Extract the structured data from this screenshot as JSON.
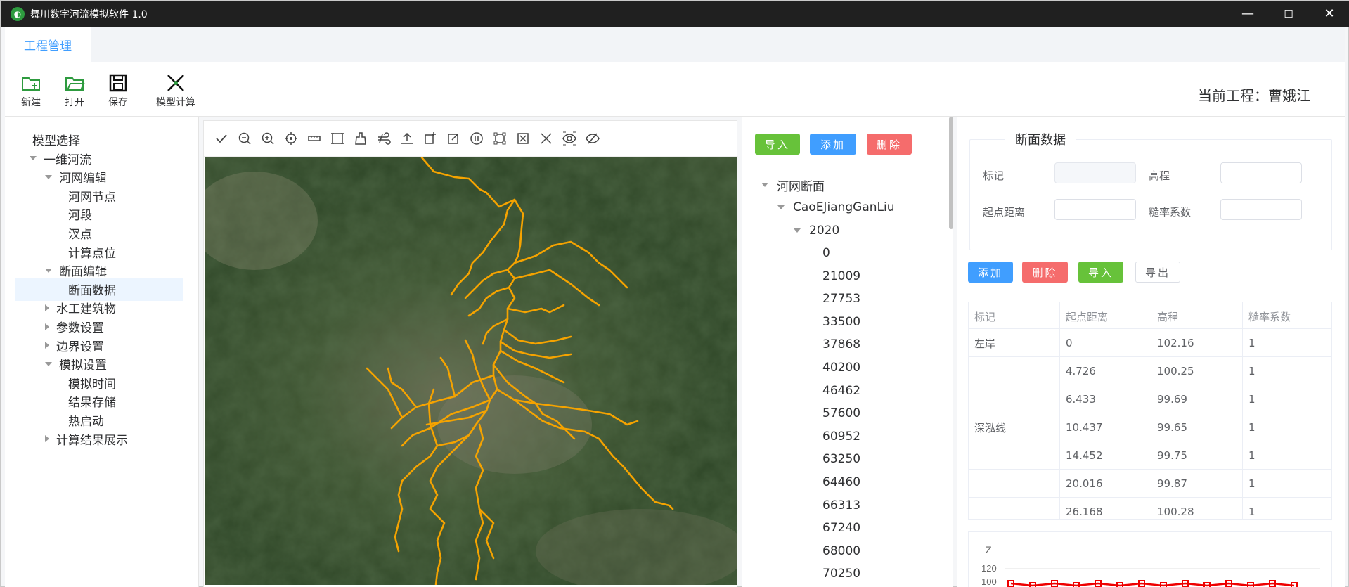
{
  "window": {
    "title": "舞川数字河流模拟软件 1.0",
    "logo_icon": "river-logo-icon",
    "controls": {
      "minimize": "—",
      "maximize": "☐",
      "close": "✕"
    }
  },
  "tabs": [
    {
      "label": "工程管理",
      "active": true
    }
  ],
  "ribbon": {
    "new_label": "新建",
    "open_label": "打开",
    "save_label": "保存",
    "compute_label": "模型计算",
    "current_project": "当前工程：曹娥江"
  },
  "sidebar": {
    "items": [
      {
        "label": "模型选择",
        "level": 0,
        "arrow": "none"
      },
      {
        "label": "一维河流",
        "level": 0,
        "arrow": "down"
      },
      {
        "label": "河网编辑",
        "level": 1,
        "arrow": "down"
      },
      {
        "label": "河网节点",
        "level": 2,
        "arrow": "none"
      },
      {
        "label": "河段",
        "level": 2,
        "arrow": "none"
      },
      {
        "label": "汊点",
        "level": 2,
        "arrow": "none"
      },
      {
        "label": "计算点位",
        "level": 2,
        "arrow": "none"
      },
      {
        "label": "断面编辑",
        "level": 1,
        "arrow": "down"
      },
      {
        "label": "断面数据",
        "level": 2,
        "arrow": "none",
        "selected": true
      },
      {
        "label": "水工建筑物",
        "level": 1,
        "arrow": "right"
      },
      {
        "label": "参数设置",
        "level": 1,
        "arrow": "right"
      },
      {
        "label": "边界设置",
        "level": 1,
        "arrow": "right"
      },
      {
        "label": "模拟设置",
        "level": 1,
        "arrow": "down"
      },
      {
        "label": "模拟时间",
        "level": 2,
        "arrow": "none"
      },
      {
        "label": "结果存储",
        "level": 2,
        "arrow": "none"
      },
      {
        "label": "热启动",
        "level": 2,
        "arrow": "none"
      },
      {
        "label": "计算结果展示",
        "level": 1,
        "arrow": "right"
      }
    ]
  },
  "map_toolbar": {
    "icons": [
      "check-icon",
      "zoom-out-icon",
      "zoom-in-icon",
      "locate-icon",
      "measure-icon",
      "extent-icon",
      "clear-icon",
      "wind-icon",
      "upload-icon",
      "add-feature-icon",
      "edit-icon",
      "pause-icon",
      "select-box-icon",
      "delete-box-icon",
      "close-icon",
      "eye-icon",
      "eye-off-icon"
    ]
  },
  "section_panel": {
    "import_label": "导入",
    "add_label": "添加",
    "delete_label": "删除",
    "tree_root": "河网断面",
    "river": "CaoEJiangGanLiu",
    "year": "2020",
    "stations": [
      "0",
      "21009",
      "27753",
      "33500",
      "37868",
      "40200",
      "46462",
      "57600",
      "60952",
      "63250",
      "64460",
      "66313",
      "67240",
      "68000",
      "70250"
    ]
  },
  "data_panel": {
    "legend": "断面数据",
    "label_mark": "标记",
    "label_elev": "高程",
    "label_dist": "起点距离",
    "label_rough": "糙率系数",
    "add_label": "添加",
    "delete_label": "删除",
    "import_label": "导入",
    "export_label": "导出",
    "columns": [
      "标记",
      "起点距离",
      "高程",
      "糙率系数"
    ],
    "rows": [
      [
        "左岸",
        "0",
        "102.16",
        "1"
      ],
      [
        "",
        "4.726",
        "100.25",
        "1"
      ],
      [
        "",
        "6.433",
        "99.69",
        "1"
      ],
      [
        "深泓线",
        "10.437",
        "99.65",
        "1"
      ],
      [
        "",
        "14.452",
        "99.75",
        "1"
      ],
      [
        "",
        "20.016",
        "99.87",
        "1"
      ],
      [
        "",
        "26.168",
        "100.28",
        "1"
      ]
    ],
    "chart_axis_label": "Z",
    "chart_ticks": [
      "120",
      "100"
    ]
  },
  "colors": {
    "accent": "#409eff",
    "green": "#67c23a",
    "red": "#f56c6c",
    "river": "#f5a300"
  }
}
